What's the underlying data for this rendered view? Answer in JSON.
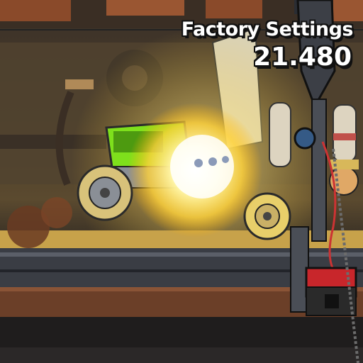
{
  "hud": {
    "title": "Factory Settings",
    "score": "21.480"
  },
  "scene": {
    "colors": {
      "explosion": "#fff6a8",
      "glow": "#ffd23a",
      "vehicle_body": "#7ee01c",
      "conveyor": "#3a3d44",
      "floor": "#6b3f28",
      "robot_arm": "#3c3f46",
      "red_box": "#c8262b"
    },
    "icons": [
      "robotic-arm",
      "conveyor-belt",
      "sawblade-wheel",
      "green-vehicle",
      "explosion",
      "red-control-box",
      "gas-cylinders",
      "worker-character"
    ]
  }
}
